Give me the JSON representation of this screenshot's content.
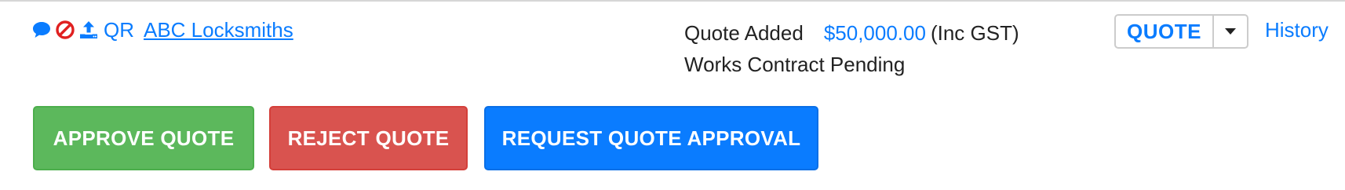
{
  "header": {
    "icons": [
      "comment-icon",
      "ban-icon",
      "upload-icon"
    ],
    "qr_label": "QR",
    "company_link": "ABC Locksmiths"
  },
  "status": {
    "label": "Quote Added",
    "amount": "$50,000.00",
    "tax_note": "(Inc GST)",
    "contract_status": "Works Contract Pending"
  },
  "quote_dropdown": {
    "selected": "QUOTE"
  },
  "history_link": "History",
  "actions": {
    "approve": "APPROVE QUOTE",
    "reject": "REJECT QUOTE",
    "request": "REQUEST QUOTE APPROVAL"
  },
  "colors": {
    "link": "#0a7cff",
    "approve": "#5cb85c",
    "reject": "#d9534f",
    "request": "#0a7cff",
    "ban": "#e02020"
  }
}
